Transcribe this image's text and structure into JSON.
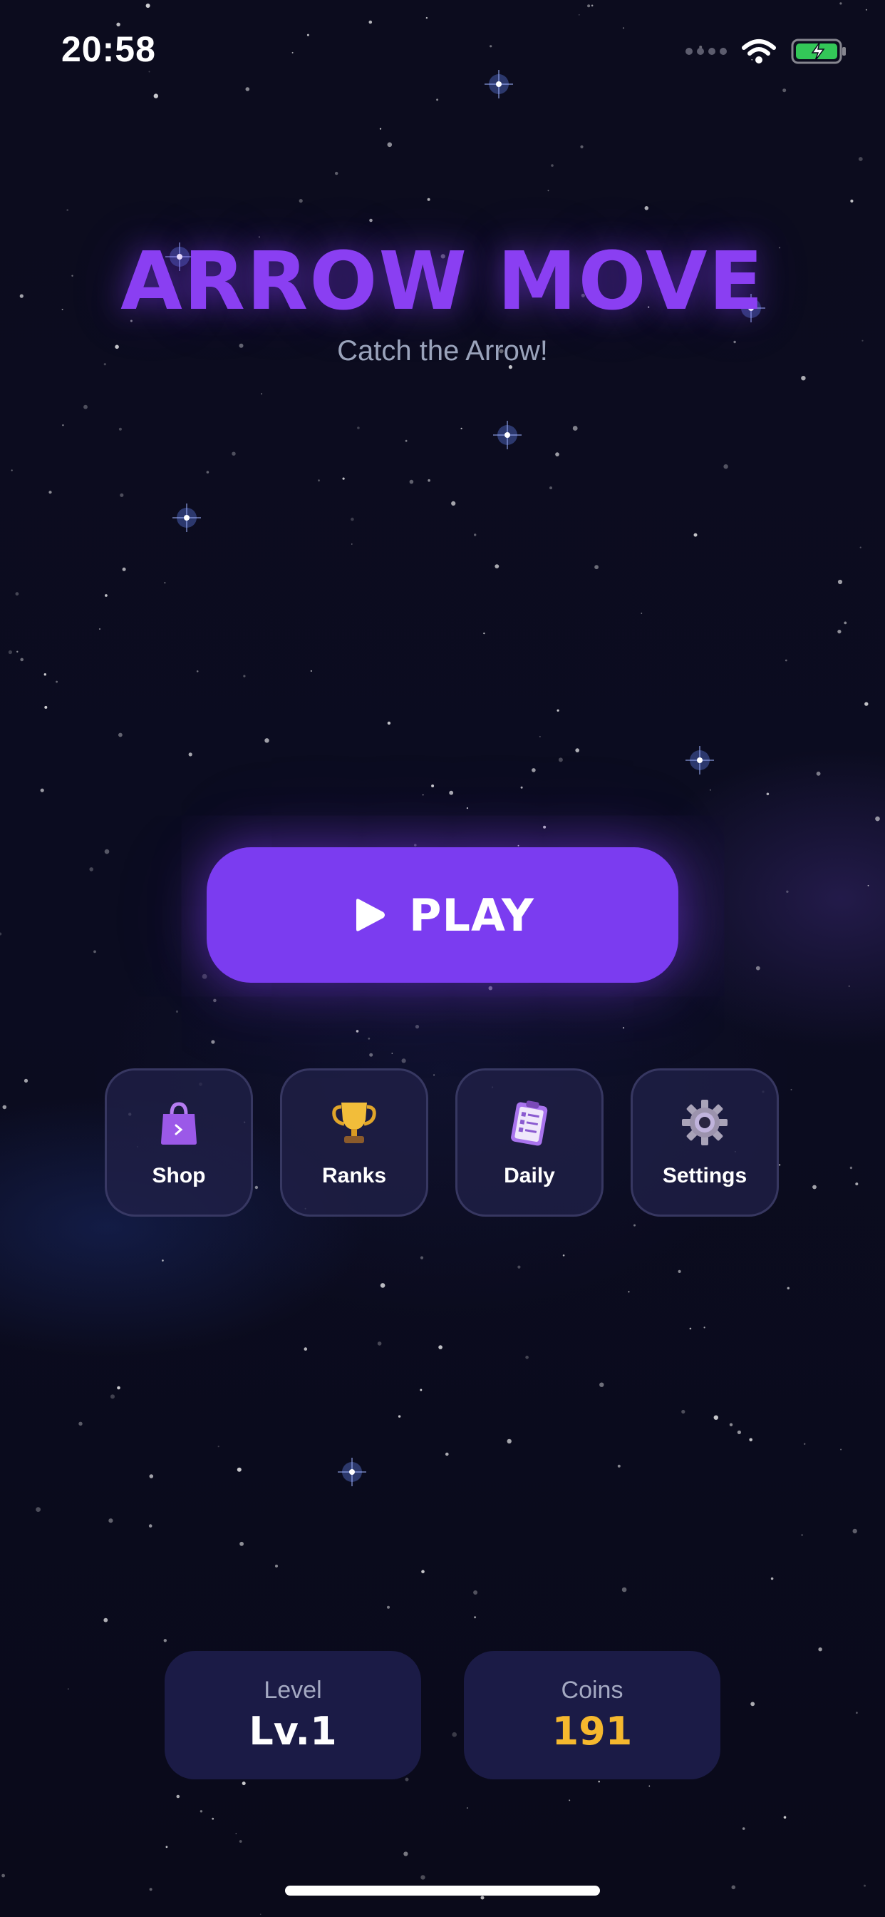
{
  "status_bar": {
    "time": "20:58",
    "icons": [
      "signal-dots-icon",
      "wifi-icon",
      "battery-charging-icon"
    ]
  },
  "header": {
    "title": "ARROW MOVE",
    "subtitle": "Catch the Arrow!"
  },
  "play": {
    "label": "PLAY",
    "icon": "play-icon"
  },
  "menu": [
    {
      "label": "Shop",
      "icon": "shopping-bag-icon"
    },
    {
      "label": "Ranks",
      "icon": "trophy-icon"
    },
    {
      "label": "Daily",
      "icon": "clipboard-checklist-icon"
    },
    {
      "label": "Settings",
      "icon": "gear-icon"
    }
  ],
  "stats": {
    "level": {
      "label": "Level",
      "value": "Lv.1"
    },
    "coins": {
      "label": "Coins",
      "value": "191"
    }
  },
  "colors": {
    "accent": "#7b3cf0",
    "title": "#8a3ff2",
    "coins_value": "#f5b82e",
    "background": "#0b0b1c",
    "card": "#1b1b46"
  }
}
